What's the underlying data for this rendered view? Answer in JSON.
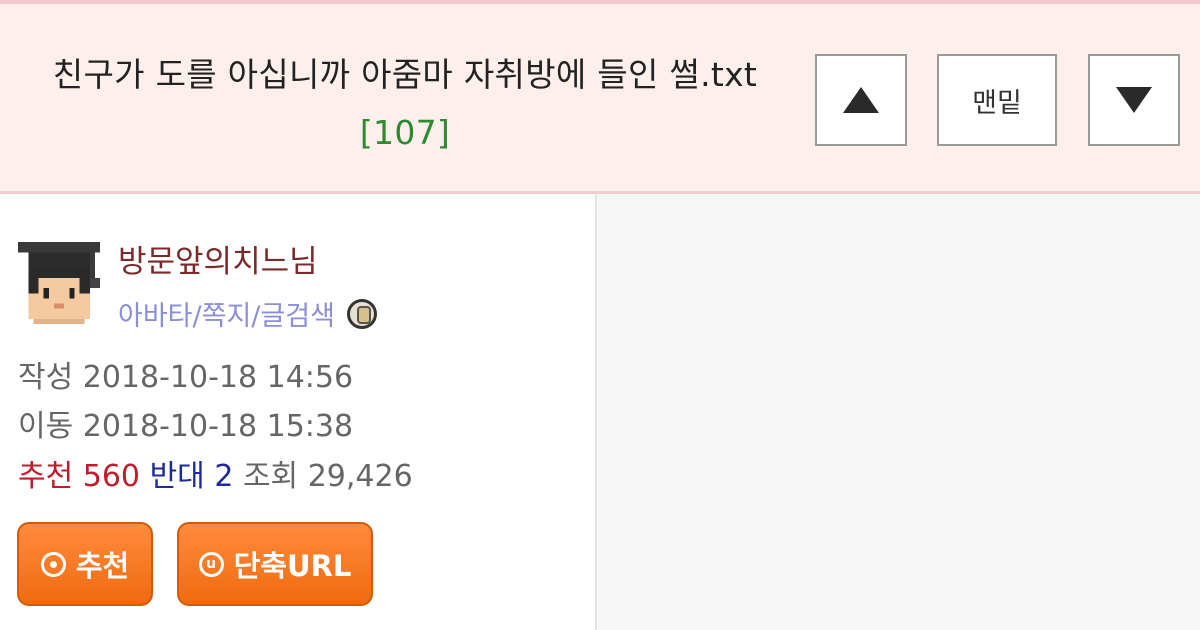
{
  "header": {
    "title": "친구가 도를 아십니까 아줌마 자취방에 들인 썰.txt",
    "comment_count": "[107]",
    "up_button_icon": "triangle-up-icon",
    "bottom_button_label": "맨밑",
    "down_button_icon": "triangle-down-icon"
  },
  "author": {
    "nickname": "방문앞의치느님",
    "links": "아바타/쪽지/글검색",
    "avatar_icon": "pixel-graduate-avatar",
    "badge_icon": "level-badge-icon"
  },
  "meta": {
    "written_label": "작성",
    "written_value": "2018-10-18 14:56",
    "moved_label": "이동",
    "moved_value": "2018-10-18 15:38",
    "recommend_label": "추천",
    "recommend_value": "560",
    "oppose_label": "반대",
    "oppose_value": "2",
    "views_label": "조회",
    "views_value": "29,426"
  },
  "actions": {
    "recommend_button": "추천",
    "short_url_button": "단축URL",
    "short_url_icon_letter": "u"
  },
  "colors": {
    "header_bg": "#fcefec",
    "accent_orange": "#f06a10",
    "count_green": "#2f8a2f",
    "recommend_red": "#c01c2c",
    "oppose_blue": "#1e2a9c",
    "link_purple": "#8a8fd6"
  }
}
